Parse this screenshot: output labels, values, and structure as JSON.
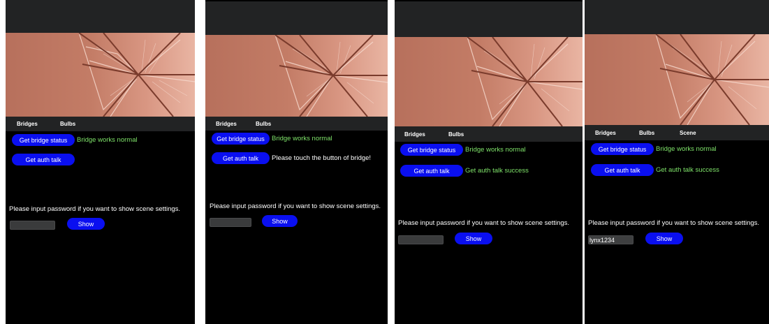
{
  "colors": {
    "background": "#000000",
    "bar": "#222324",
    "button": "#0a0ff0",
    "success": "#7fe36a",
    "info": "#ffffff"
  },
  "hero_image": "geodesic-dome-ceiling-photo",
  "screens": [
    {
      "tabs": [
        "Bridges",
        "Bulbs"
      ],
      "bridge_button": "Get bridge status",
      "bridge_msg": "Bridge works normal",
      "auth_button": "Get auth talk",
      "auth_msg": "",
      "prompt": "Please input password if you want to show scene settings.",
      "password_value": "",
      "show_button": "Show"
    },
    {
      "tabs": [
        "Bridges",
        "Bulbs"
      ],
      "bridge_button": "Get bridge status",
      "bridge_msg": "Bridge works normal",
      "auth_button": "Get auth talk",
      "auth_msg": "Please touch the button of bridge!",
      "prompt": "Please input password if you want to show scene settings.",
      "password_value": "",
      "show_button": "Show"
    },
    {
      "tabs": [
        "Bridges",
        "Bulbs"
      ],
      "bridge_button": "Get bridge status",
      "bridge_msg": "Bridge works normal",
      "auth_button": "Get auth talk",
      "auth_msg": "Get auth talk success",
      "prompt": "Please input password if you want to show scene settings.",
      "password_value": "",
      "show_button": "Show"
    },
    {
      "tabs": [
        "Bridges",
        "Bulbs",
        "Scene"
      ],
      "bridge_button": "Get bridge status",
      "bridge_msg": "Bridge works normal",
      "auth_button": "Get auth talk",
      "auth_msg": "Get auth talk success",
      "prompt": "Please input password if you want to show scene settings.",
      "password_value": "lynx1234",
      "show_button": "Show"
    }
  ]
}
